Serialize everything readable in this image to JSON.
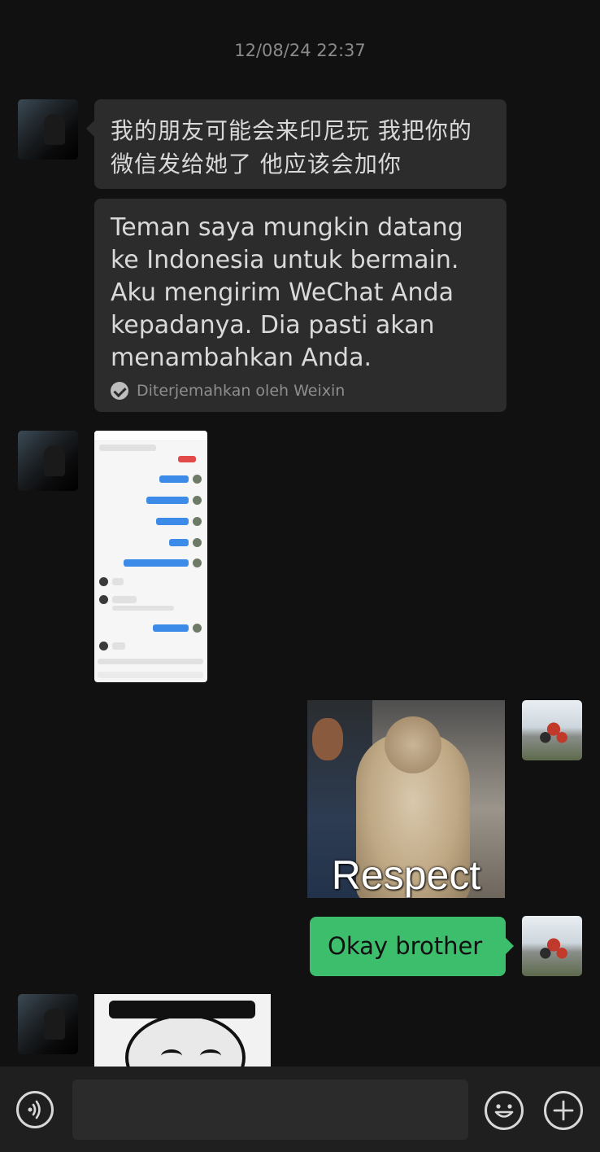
{
  "timestamp": "12/08/24 22:37",
  "messages": [
    {
      "sender": "friend",
      "type": "text",
      "text": "我的朋友可能会来印尼玩 我把你的微信发给她了 他应该会加你",
      "translation": "Teman saya mungkin datang ke Indonesia untuk bermain. Aku mengirim WeChat Anda kepadanya. Dia pasti akan menambahkan Anda.",
      "translated_by": "Diterjemahkan oleh Weixin"
    },
    {
      "sender": "friend",
      "type": "image",
      "description": "chat-screenshot"
    },
    {
      "sender": "me",
      "type": "image",
      "caption": "Respect"
    },
    {
      "sender": "me",
      "type": "text",
      "text": "Okay brother"
    },
    {
      "sender": "friend",
      "type": "image",
      "description": "sticker"
    }
  ],
  "input_bar": {
    "voice_icon": "voice-icon",
    "emoji_icon": "emoji-icon",
    "plus_icon": "plus-icon"
  },
  "colors": {
    "background": "#111111",
    "bubble_friend": "#2c2c2c",
    "bubble_me": "#3dbe6c",
    "timestamp": "#8a8a8a"
  }
}
